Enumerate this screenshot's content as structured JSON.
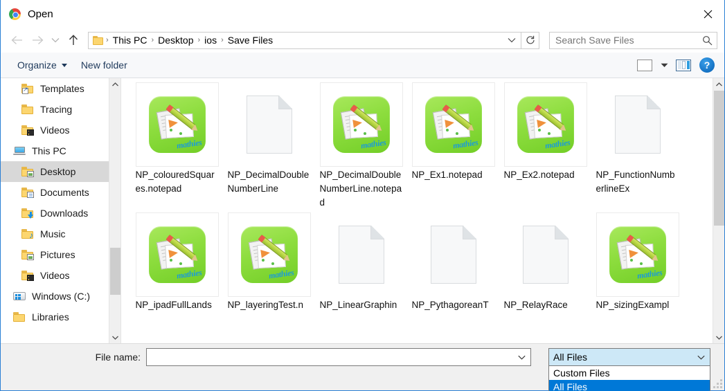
{
  "window": {
    "title": "Open",
    "app_icon": "chrome-icon",
    "close_label": "✕"
  },
  "address_bar": {
    "back_icon": "back-arrow-icon",
    "forward_icon": "forward-arrow-icon",
    "recent_icon": "chevron-down-icon",
    "up_icon": "up-arrow-icon",
    "folder_icon": "folder-icon",
    "breadcrumbs": [
      "This PC",
      "Desktop",
      "ios",
      "Save Files"
    ],
    "separator": "›",
    "dropdown_icon": "chevron-down-icon",
    "refresh_icon": "refresh-icon"
  },
  "search": {
    "placeholder": "Search Save Files",
    "icon": "search-icon"
  },
  "toolbar": {
    "organize_label": "Organize",
    "new_folder_label": "New folder",
    "view_icon": "view-mode-icon",
    "view_caret_icon": "chevron-down-icon",
    "preview_pane_icon": "preview-pane-icon",
    "help_label": "?"
  },
  "sidebar": {
    "items": [
      {
        "label": "Templates",
        "icon": "folder-shortcut-icon",
        "level": "child",
        "selected": false
      },
      {
        "label": "Tracing",
        "icon": "folder-icon",
        "level": "child",
        "selected": false
      },
      {
        "label": "Videos",
        "icon": "folder-videos-icon",
        "level": "child",
        "selected": false
      },
      {
        "label": "This PC",
        "icon": "this-pc-icon",
        "level": "root",
        "selected": false
      },
      {
        "label": "Desktop",
        "icon": "folder-desktop-icon",
        "level": "child",
        "selected": true
      },
      {
        "label": "Documents",
        "icon": "folder-documents-icon",
        "level": "child",
        "selected": false
      },
      {
        "label": "Downloads",
        "icon": "folder-downloads-icon",
        "level": "child",
        "selected": false
      },
      {
        "label": "Music",
        "icon": "folder-music-icon",
        "level": "child",
        "selected": false
      },
      {
        "label": "Pictures",
        "icon": "folder-pictures-icon",
        "level": "child",
        "selected": false
      },
      {
        "label": "Videos",
        "icon": "folder-videos-icon",
        "level": "child",
        "selected": false
      },
      {
        "label": "Windows (C:)",
        "icon": "drive-windows-icon",
        "level": "root",
        "selected": false
      },
      {
        "label": "Libraries",
        "icon": "folder-icon",
        "level": "root",
        "selected": false
      }
    ],
    "scroll_up_icon": "chevron-up-icon",
    "scroll_down_icon": "chevron-down-icon"
  },
  "files": {
    "rows": [
      [
        {
          "name": "NP_colouredSquares.notepad",
          "icon": "mathies-notepad-icon"
        },
        {
          "name": "NP_DecimalDoubleNumberLine",
          "icon": "blank-document-icon"
        },
        {
          "name": "NP_DecimalDoubleNumberLine.notepad",
          "icon": "mathies-notepad-icon"
        },
        {
          "name": "NP_Ex1.notepad",
          "icon": "mathies-notepad-icon"
        },
        {
          "name": "NP_Ex2.notepad",
          "icon": "mathies-notepad-icon"
        },
        {
          "name": "NP_FunctionNumberlineEx",
          "icon": "blank-document-icon"
        }
      ],
      [
        {
          "name": "NP_ipadFullLands",
          "icon": "mathies-notepad-icon"
        },
        {
          "name": "NP_layeringTest.n",
          "icon": "mathies-notepad-icon"
        },
        {
          "name": "NP_LinearGraphin",
          "icon": "blank-document-icon"
        },
        {
          "name": "NP_PythagoreanT",
          "icon": "blank-document-icon"
        },
        {
          "name": "NP_RelayRace",
          "icon": "blank-document-icon"
        },
        {
          "name": "NP_sizingExampl",
          "icon": "mathies-notepad-icon"
        }
      ]
    ],
    "app_icon_caption": "mathies",
    "scroll_up_icon": "chevron-up-icon",
    "scroll_down_icon": "chevron-down-icon"
  },
  "footer": {
    "filename_label": "File name:",
    "filename_value": "",
    "filename_placeholder": "",
    "filename_caret_icon": "chevron-down-icon",
    "filter": {
      "selected": "All Files",
      "caret_icon": "chevron-down-icon",
      "options": [
        {
          "label": "Custom Files",
          "selected": false
        },
        {
          "label": "All Files",
          "selected": true
        }
      ]
    },
    "resize_grip_icon": "resize-grip-icon"
  },
  "colors": {
    "accent_blue": "#0078d7",
    "combo_highlight": "#cde8f7",
    "selected_row": "#d8d8d8",
    "toolbar_bg": "#f7f8fa",
    "footer_bg": "#f0f0f0",
    "app_icon_green": "#8ddd3e"
  }
}
